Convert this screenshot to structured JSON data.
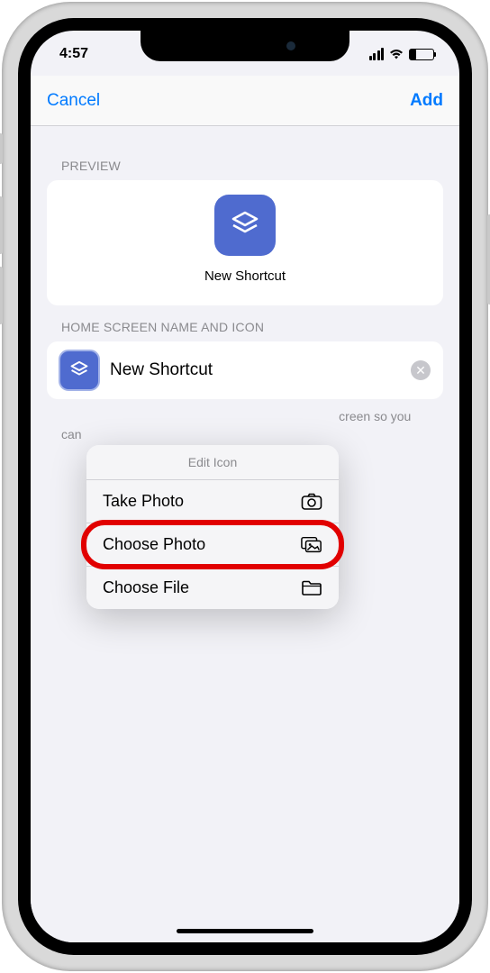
{
  "status": {
    "time": "4:57"
  },
  "nav": {
    "cancel": "Cancel",
    "add": "Add"
  },
  "sections": {
    "preview": "Preview",
    "home_screen": "Home Screen Name and Icon"
  },
  "preview": {
    "shortcut_name": "New Shortcut"
  },
  "name_field": {
    "value": "New Shortcut"
  },
  "helper": {
    "suffix": "creen so you can"
  },
  "popup": {
    "title": "Edit Icon",
    "items": [
      {
        "label": "Take Photo",
        "icon": "camera-icon"
      },
      {
        "label": "Choose Photo",
        "icon": "photos-icon"
      },
      {
        "label": "Choose File",
        "icon": "folder-icon"
      }
    ]
  },
  "colors": {
    "accent": "#007aff",
    "icon_bg": "#4f6bcf",
    "highlight": "#e10000"
  }
}
